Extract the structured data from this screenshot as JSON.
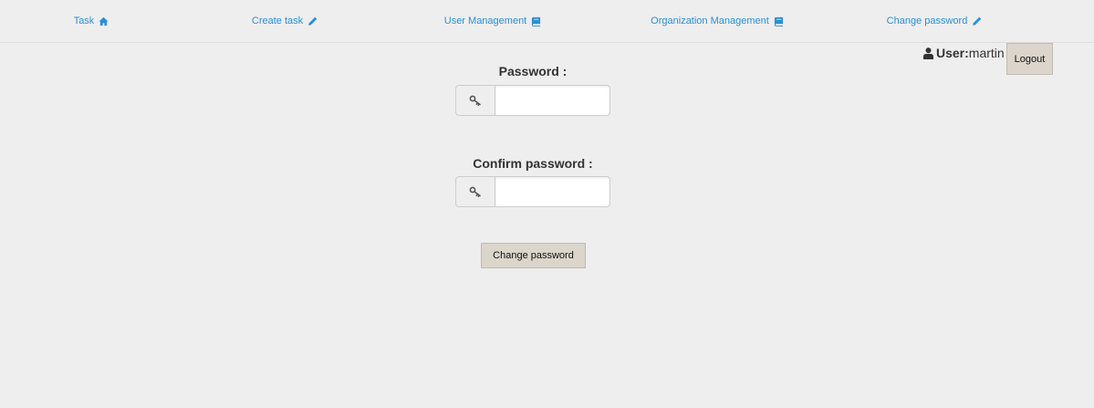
{
  "nav": {
    "items": [
      {
        "label": "Task",
        "icon": "home-icon"
      },
      {
        "label": "Create task",
        "icon": "pencil-icon"
      },
      {
        "label": "User Management",
        "icon": "book-icon"
      },
      {
        "label": "Organization Management",
        "icon": "book-icon"
      },
      {
        "label": "Change password",
        "icon": "pencil-icon"
      }
    ],
    "link_color": "#2a8fd6"
  },
  "user": {
    "label": "User:",
    "name": "martin",
    "icon": "user-icon"
  },
  "logout": {
    "label": "Logout"
  },
  "form": {
    "password_label": "Password :",
    "password_value": "",
    "confirm_label": "Confirm password :",
    "confirm_value": "",
    "field_icon": "key-icon",
    "submit_label": "Change password"
  },
  "colors": {
    "background": "#eeeeee",
    "button_bg": "#dbd5cc",
    "text": "#333333"
  }
}
